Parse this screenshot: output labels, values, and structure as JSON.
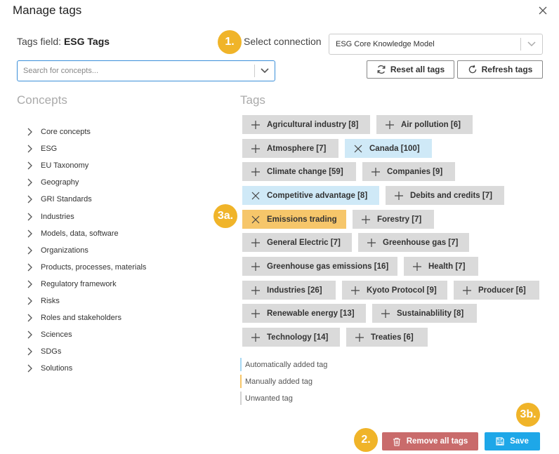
{
  "dialog": {
    "title": "Manage tags"
  },
  "tags_field": {
    "label": "Tags field:",
    "value": "ESG Tags"
  },
  "connection": {
    "label": "Select connection",
    "selected": "ESG Core Knowledge Model"
  },
  "search": {
    "placeholder": "Search for concepts...",
    "value": ""
  },
  "toolbar": {
    "reset_label": "Reset all tags",
    "refresh_label": "Refresh tags"
  },
  "concepts": {
    "heading": "Concepts",
    "items": [
      "Core concepts",
      "ESG",
      "EU Taxonomy",
      "Geography",
      "GRI Standards",
      "Industries",
      "Models, data, software",
      "Organizations",
      "Products, processes, materials",
      "Regulatory framework",
      "Risks",
      "Roles and stakeholders",
      "Sciences",
      "SDGs",
      "Solutions"
    ]
  },
  "tags": {
    "heading": "Tags",
    "items": [
      {
        "label": "Agricultural industry [8]",
        "state": "unwanted",
        "icon": "plus-icon"
      },
      {
        "label": "Air pollution [6]",
        "state": "unwanted",
        "icon": "plus-icon"
      },
      {
        "label": "Atmosphere [7]",
        "state": "unwanted",
        "icon": "plus-icon"
      },
      {
        "label": "Canada [100]",
        "state": "auto",
        "icon": "close-icon"
      },
      {
        "label": "Climate change [59]",
        "state": "unwanted",
        "icon": "plus-icon"
      },
      {
        "label": "Companies [9]",
        "state": "unwanted",
        "icon": "plus-icon"
      },
      {
        "label": "Competitive advantage [8]",
        "state": "auto",
        "icon": "close-icon"
      },
      {
        "label": "Debits and credits [7]",
        "state": "unwanted",
        "icon": "plus-icon"
      },
      {
        "label": "Emissions trading",
        "state": "manual",
        "icon": "close-icon"
      },
      {
        "label": "Forestry [7]",
        "state": "unwanted",
        "icon": "plus-icon"
      },
      {
        "label": "General Electric [7]",
        "state": "unwanted",
        "icon": "plus-icon"
      },
      {
        "label": "Greenhouse gas [7]",
        "state": "unwanted",
        "icon": "plus-icon"
      },
      {
        "label": "Greenhouse gas emissions [16]",
        "state": "unwanted",
        "icon": "plus-icon"
      },
      {
        "label": "Health [7]",
        "state": "unwanted",
        "icon": "plus-icon"
      },
      {
        "label": "Industries [26]",
        "state": "unwanted",
        "icon": "plus-icon"
      },
      {
        "label": "Kyoto Protocol [9]",
        "state": "unwanted",
        "icon": "plus-icon"
      },
      {
        "label": "Producer [6]",
        "state": "unwanted",
        "icon": "plus-icon"
      },
      {
        "label": "Renewable energy [13]",
        "state": "unwanted",
        "icon": "plus-icon"
      },
      {
        "label": "Sustainablility [8]",
        "state": "unwanted",
        "icon": "plus-icon"
      },
      {
        "label": "Technology [14]",
        "state": "unwanted",
        "icon": "plus-icon"
      },
      {
        "label": "Treaties [6]",
        "state": "unwanted",
        "icon": "plus-icon"
      }
    ]
  },
  "legend": {
    "auto": "Automatically added tag",
    "manual": "Manually added tag",
    "unwanted": "Unwanted tag"
  },
  "callouts": {
    "one": "1.",
    "two": "2.",
    "three_a": "3a.",
    "three_b": "3b."
  },
  "footer": {
    "remove_label": "Remove all tags",
    "save_label": "Save"
  },
  "colors": {
    "accent": "#1ea7e8",
    "danger": "#c96b6b",
    "callout": "#f0b429",
    "tag_auto": "#cfe9f7",
    "tag_manual": "#f6c66a",
    "tag_unwanted": "#dadada"
  }
}
